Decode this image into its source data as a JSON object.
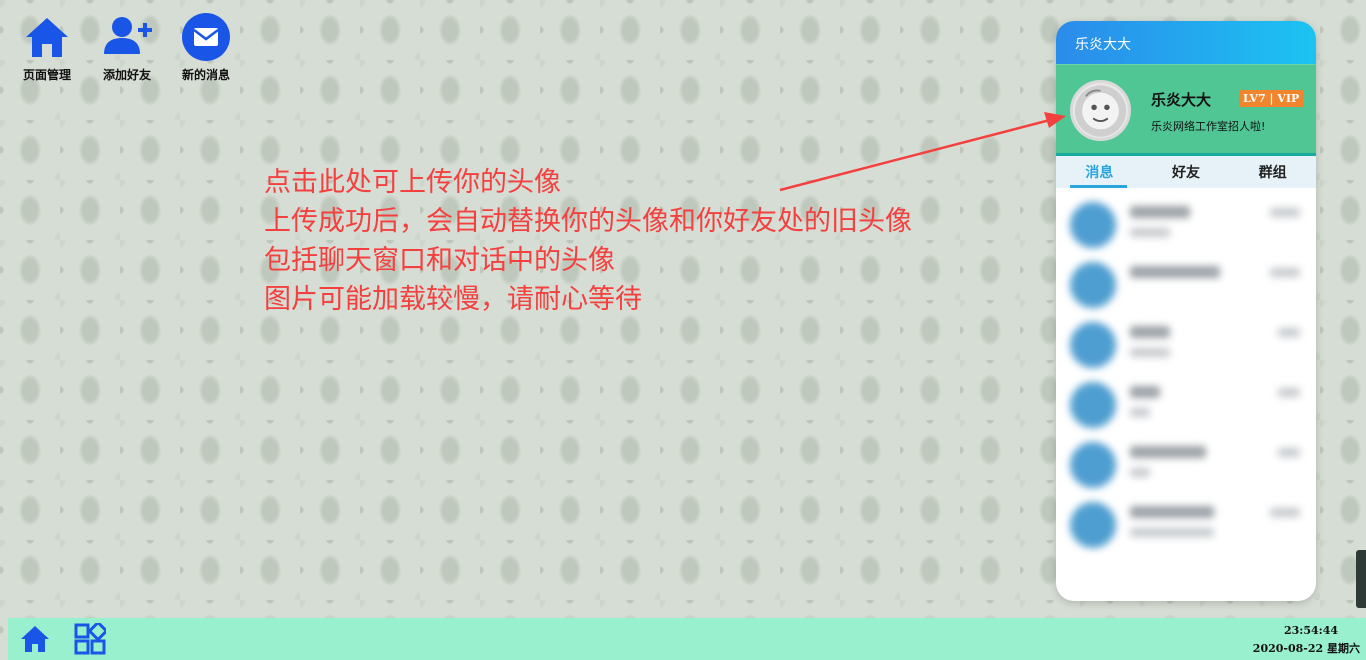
{
  "desktop": {
    "icons": [
      {
        "label": "页面管理",
        "icon": "home-icon"
      },
      {
        "label": "添加好友",
        "icon": "add-user-icon"
      },
      {
        "label": "新的消息",
        "icon": "envelope-icon"
      }
    ]
  },
  "annotation": {
    "lines": [
      "点击此处可上传你的头像",
      "上传成功后，会自动替换你的头像和你好友处的旧头像",
      "包括聊天窗口和对话中的头像",
      "图片可能加载较慢，请耐心等待"
    ],
    "color": "#f4403f"
  },
  "chat_panel": {
    "title": "乐炎大大",
    "profile": {
      "name": "乐炎大大",
      "level_badge": "LV7 | VIP",
      "motto": "乐炎网络工作室招人啦!"
    },
    "tabs": [
      "消息",
      "好友",
      "群组"
    ],
    "active_tab": "消息",
    "header_gradient": [
      "#2b8bea",
      "#1cc3f2"
    ],
    "profile_bg": "#4fc694"
  },
  "taskbar": {
    "time": "23:54:44",
    "date": "2020-08-22 星期六",
    "bg": "#98f0cf"
  }
}
